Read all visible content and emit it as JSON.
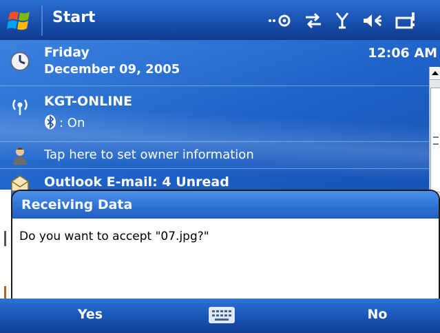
{
  "titlebar": {
    "title": "Start"
  },
  "today": {
    "day": "Friday",
    "date": "December 09, 2005",
    "time": "12:06 AM",
    "network_name": "KGT-ONLINE",
    "bluetooth_status": ": On",
    "owner_prompt": "Tap here to set owner information",
    "email_summary": "Outlook E-mail: 4 Unread"
  },
  "dialog": {
    "title": "Receiving Data",
    "message": "Do you want to accept \"07.jpg?\""
  },
  "softkeys": {
    "left": "Yes",
    "right": "No"
  },
  "icons": {
    "start": "windows-flag-icon",
    "tray": [
      "connectivity-icon",
      "sync-icon",
      "signal-icon",
      "volume-icon",
      "battery-icon"
    ],
    "rows": [
      "clock-icon",
      "wireless-icon",
      "owner-icon",
      "email-icon"
    ],
    "keyboard": "keyboard-icon"
  },
  "colors": {
    "accent": "#1c56b5",
    "dialog_title": "#2f73d4"
  }
}
